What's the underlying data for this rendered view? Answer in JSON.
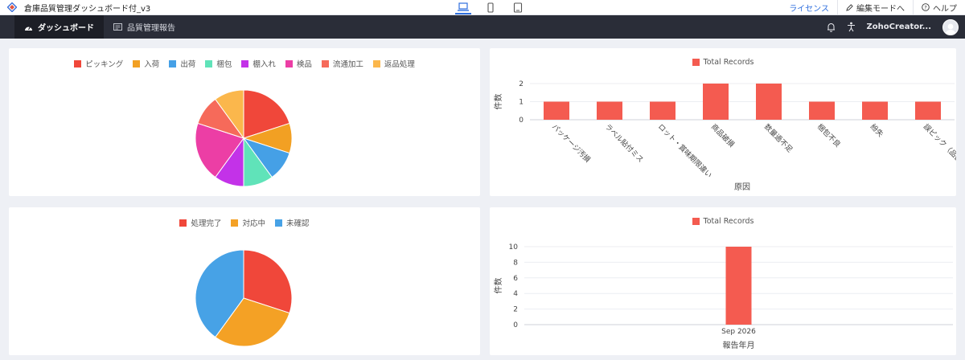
{
  "app": {
    "title": "倉庫品質管理ダッシュボード付_v3",
    "license_label": "ライセンス",
    "edit_mode_label": "編集モードへ",
    "help_label": "ヘルプ"
  },
  "nav": {
    "tabs": [
      {
        "label": "ダッシュボード",
        "icon": "dashboard-icon",
        "active": true
      },
      {
        "label": "品質管理報告",
        "icon": "report-icon",
        "active": false
      }
    ],
    "user_name": "ZohoCreator..."
  },
  "chart_data": [
    {
      "type": "pie",
      "categories": [
        "ピッキング",
        "入荷",
        "出荷",
        "梱包",
        "棚入れ",
        "検品",
        "流通加工",
        "返品処理"
      ],
      "values": [
        2,
        1,
        1,
        1,
        1,
        2,
        1,
        1
      ],
      "colors": [
        "#f0473a",
        "#f2a023",
        "#45a0e6",
        "#60e3b9",
        "#c332e8",
        "#ec3ea5",
        "#f66a5a",
        "#fbb74c"
      ]
    },
    {
      "type": "bar",
      "series": [
        {
          "name": "Total Records",
          "values": [
            1,
            1,
            1,
            2,
            2,
            1,
            1,
            1
          ],
          "color": "#f45b50"
        }
      ],
      "categories": [
        "パッケージ汚損",
        "ラベル貼付ミス",
        "ロット・賞味期限違い",
        "商品破損",
        "数量過不足",
        "梱包不良",
        "紛失",
        "誤ピック（品番…"
      ],
      "xlabel": "原因",
      "ylabel": "件数",
      "yticks": [
        0,
        1,
        2
      ],
      "ylim": [
        0,
        2
      ]
    },
    {
      "type": "pie",
      "categories": [
        "処理完了",
        "対応中",
        "未確認"
      ],
      "values": [
        3,
        3,
        4
      ],
      "colors": [
        "#f0473a",
        "#f4a125",
        "#47a2e6"
      ]
    },
    {
      "type": "bar",
      "series": [
        {
          "name": "Total Records",
          "values": [
            10
          ],
          "color": "#f45b50"
        }
      ],
      "categories": [
        "Sep 2026"
      ],
      "xlabel": "報告年月",
      "ylabel": "件数",
      "yticks": [
        0,
        2,
        4,
        6,
        8,
        10
      ],
      "ylim": [
        0,
        10
      ]
    }
  ]
}
